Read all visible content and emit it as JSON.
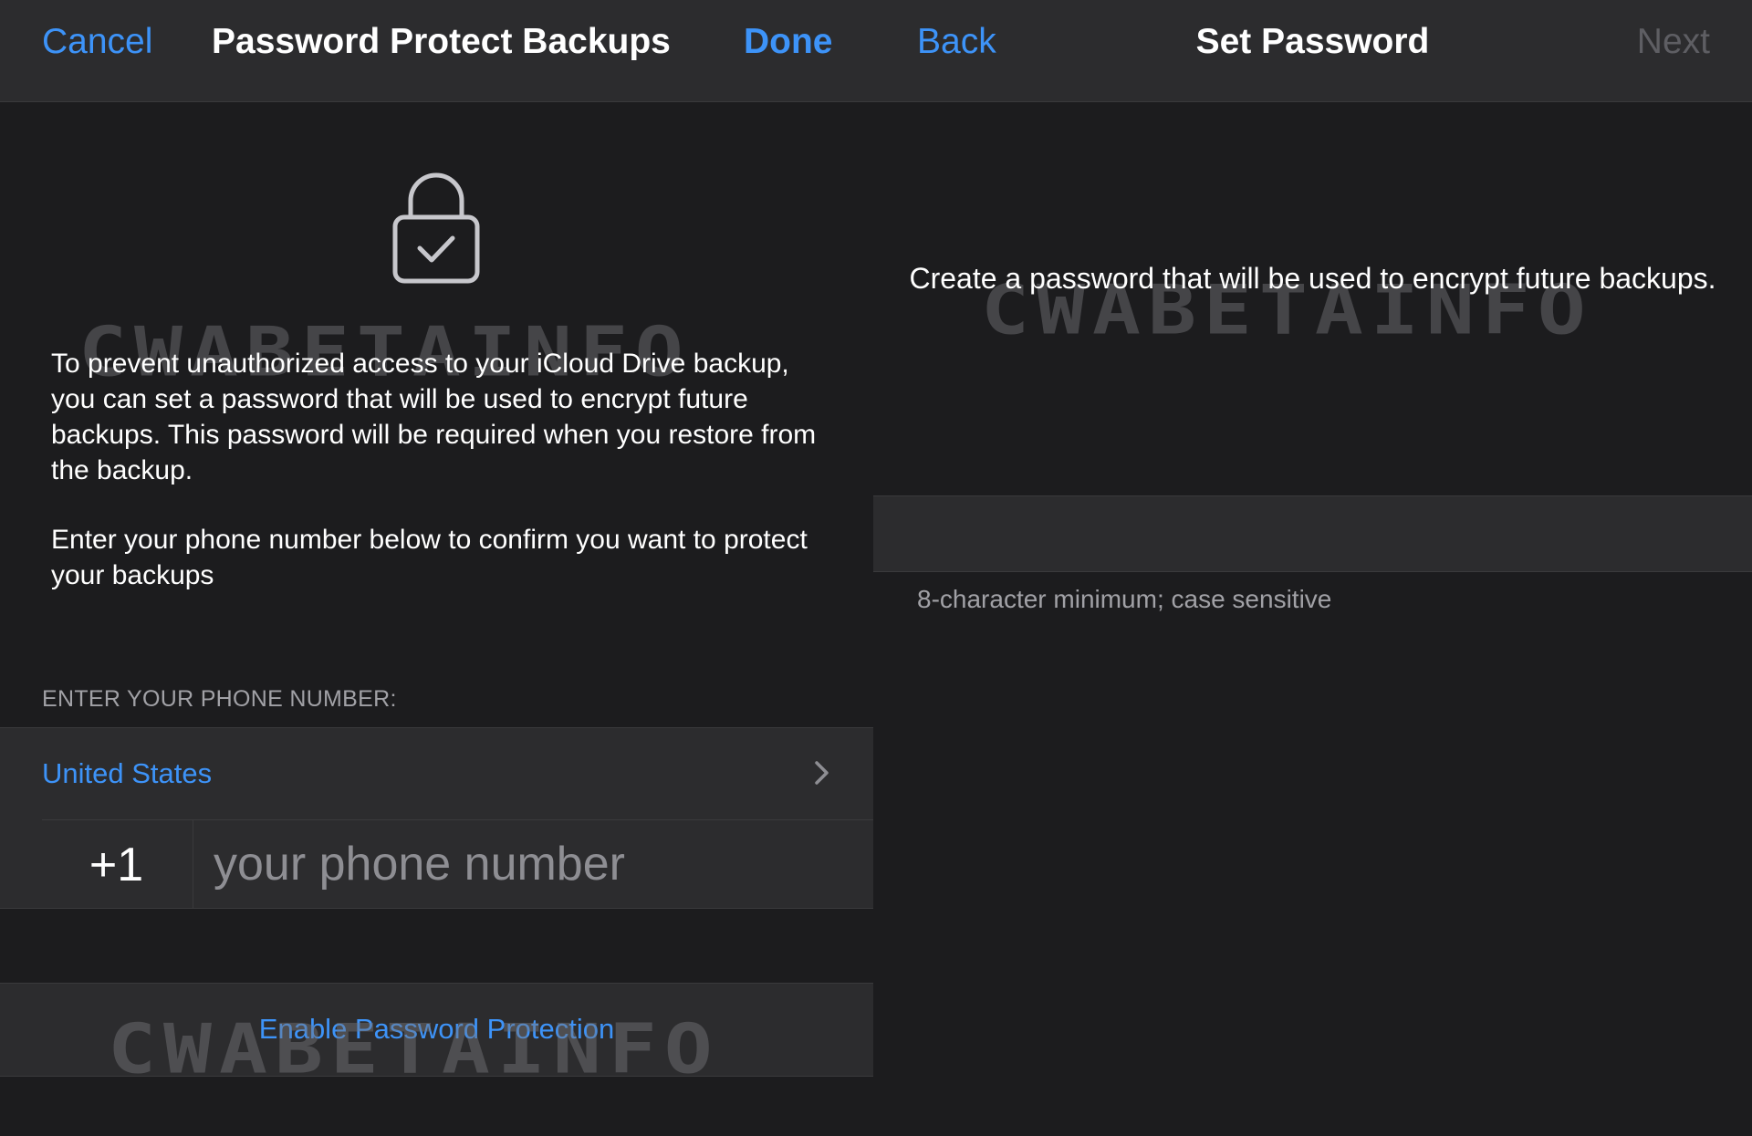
{
  "left_screen": {
    "navbar": {
      "cancel_label": "Cancel",
      "title": "Password Protect Backups",
      "done_label": "Done"
    },
    "lock_icon": "lock-check-icon",
    "intro_text": "To prevent unauthorized access to your iCloud Drive backup, you can set a password that will be used to encrypt future backups. This password will be required when you restore from the backup.",
    "confirm_text": "Enter your phone number below to confirm you want to protect your backups",
    "phone_section_label": "ENTER YOUR PHONE NUMBER:",
    "country": {
      "name": "United States",
      "chevron_icon": "chevron-right-icon"
    },
    "phone": {
      "country_code": "+1",
      "placeholder": "your phone number",
      "value": ""
    },
    "enable_button_label": "Enable Password Protection",
    "watermark_text": "CWABETAINFO"
  },
  "right_screen": {
    "navbar": {
      "back_label": "Back",
      "title": "Set Password",
      "next_label": "Next"
    },
    "create_text": "Create a password that will be used to encrypt future backups.",
    "password": {
      "value": "",
      "placeholder": ""
    },
    "hint_text": "8-character minimum; case sensitive",
    "watermark_text": "CWABETAINFO"
  },
  "colors": {
    "background": "#1c1c1e",
    "cell_background": "#2c2c2e",
    "accent_blue": "#3d93f8",
    "disabled_text": "#5e5e63",
    "secondary_text": "#a1a1a6"
  }
}
